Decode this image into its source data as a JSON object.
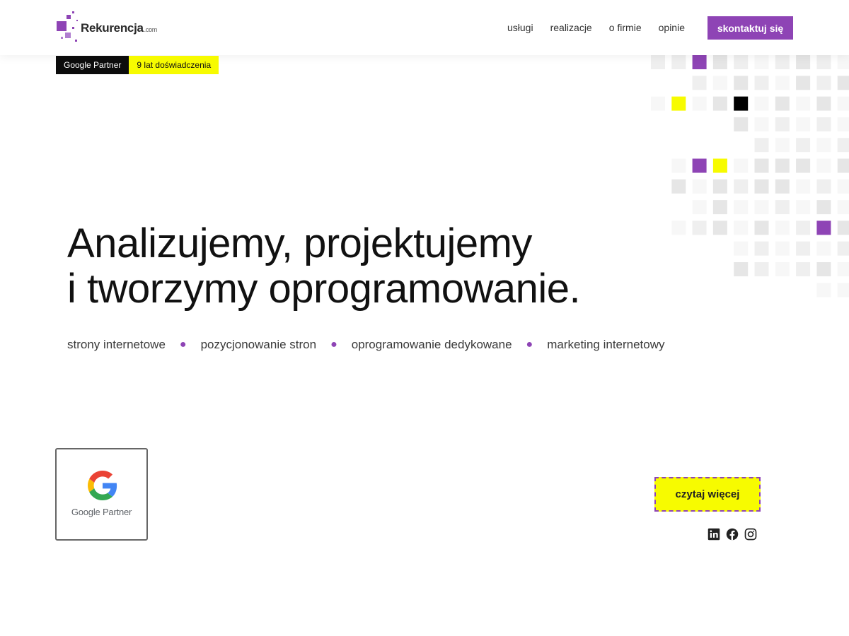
{
  "brand": {
    "name": "Rekurencja",
    "suffix": ".com",
    "accent": "#8e44b5",
    "highlight": "#f7fb00"
  },
  "nav": {
    "items": [
      "usługi",
      "realizacje",
      "o firmie",
      "opinie"
    ],
    "cta": "skontaktuj się"
  },
  "badges": {
    "partner": "Google Partner",
    "experience": "9 lat doświadczenia"
  },
  "hero": {
    "line1": "Analizujemy, projektujemy",
    "line2": "i tworzymy oprogramowanie.",
    "services": [
      "strony internetowe",
      "pozycjonowanie stron",
      "oprogramowanie dedykowane",
      "marketing internetowy"
    ]
  },
  "google_partner_card": {
    "label": "Google Partner"
  },
  "read_more": "czytaj więcej",
  "social_icons": [
    "linkedin-icon",
    "facebook-icon",
    "instagram-icon"
  ]
}
